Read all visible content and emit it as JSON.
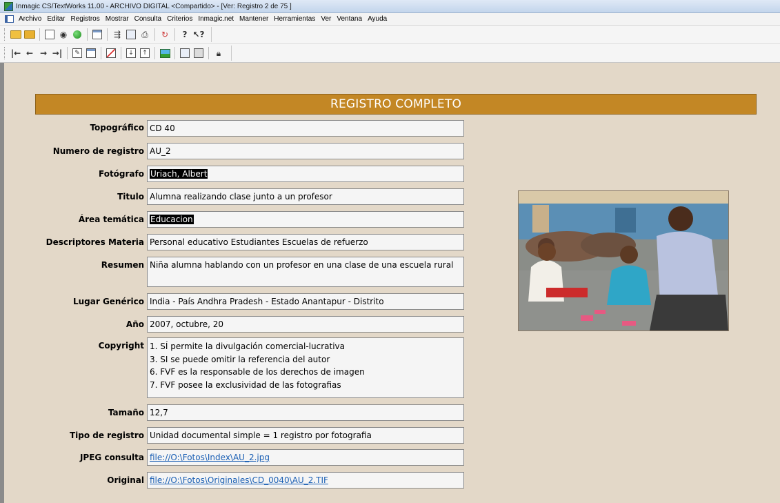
{
  "window": {
    "title": "Inmagic CS/TextWorks 11.00  - ARCHIVO DIGITAL <Compartido> - [Ver: Registro 2 de 75 ]"
  },
  "menu": [
    "Archivo",
    "Editar",
    "Registros",
    "Mostrar",
    "Consulta",
    "Criterios",
    "Inmagic.net",
    "Mantener",
    "Herramientas",
    "Ver",
    "Ventana",
    "Ayuda"
  ],
  "toolbar1_icons": [
    "open-folder-icon",
    "open-shared-icon",
    "new-record-icon",
    "view-icon",
    "green-globe-icon",
    "form-icon",
    "query-icon",
    "report-icon",
    "print-icon",
    "refresh-icon",
    "help-icon",
    "context-help-icon"
  ],
  "toolbar2_icons": [
    "first-record-icon",
    "prev-record-icon",
    "next-record-icon",
    "last-record-icon",
    "edit-record-icon",
    "copy-record-icon",
    "delete-record-icon",
    "import-icon",
    "export-icon",
    "image-icon",
    "display-form-icon",
    "blank-form-icon",
    "lock-icon"
  ],
  "header": {
    "title": "REGISTRO COMPLETO"
  },
  "fields": {
    "topografico": {
      "label": "Topográfico",
      "value": "CD 40"
    },
    "numero_registro": {
      "label": "Numero de registro",
      "value": "AU_2"
    },
    "fotografo": {
      "label": "Fotógrafo",
      "value": "Uriach, Albert"
    },
    "titulo": {
      "label": "Titulo",
      "value": "Alumna realizando clase junto a un profesor"
    },
    "area_tematica": {
      "label": "Área temática",
      "value": "Educacion"
    },
    "descriptores": {
      "label": "Descriptores Materia",
      "value": "Personal educativo Estudiantes Escuelas de refuerzo"
    },
    "resumen": {
      "label": "Resumen",
      "value": "Niña alumna hablando con un profesor en una clase de una escuela rural"
    },
    "lugar": {
      "label": "Lugar Genérico",
      "value": "India - País Andhra Pradesh - Estado Anantapur - Distrito"
    },
    "anio": {
      "label": "Año",
      "value": "2007, octubre, 20"
    },
    "copyright": {
      "label": "Copyright",
      "lines": [
        "1. SÍ permite la divulgación comercial-lucrativa",
        "3. SI se puede omitir la referencia del autor",
        "6. FVF es la responsable de los derechos de imagen",
        "7. FVF posee la exclusividad de las fotografias"
      ]
    },
    "tamano": {
      "label": "Tamaño",
      "value": "12,7"
    },
    "tipo_registro": {
      "label": "Tipo de registro",
      "value": "Unidad documental simple = 1 registro por fotografia"
    },
    "jpeg": {
      "label": "JPEG consulta",
      "value": "file://O:\\Fotos\\Index\\AU_2.jpg"
    },
    "original": {
      "label": "Original",
      "value": "file://O:\\Fotos\\Originales\\CD_0040\\AU_2.TIF"
    }
  },
  "colors": {
    "band": "#c38725",
    "background": "#e3d8c8",
    "link": "#1a5fb4"
  }
}
